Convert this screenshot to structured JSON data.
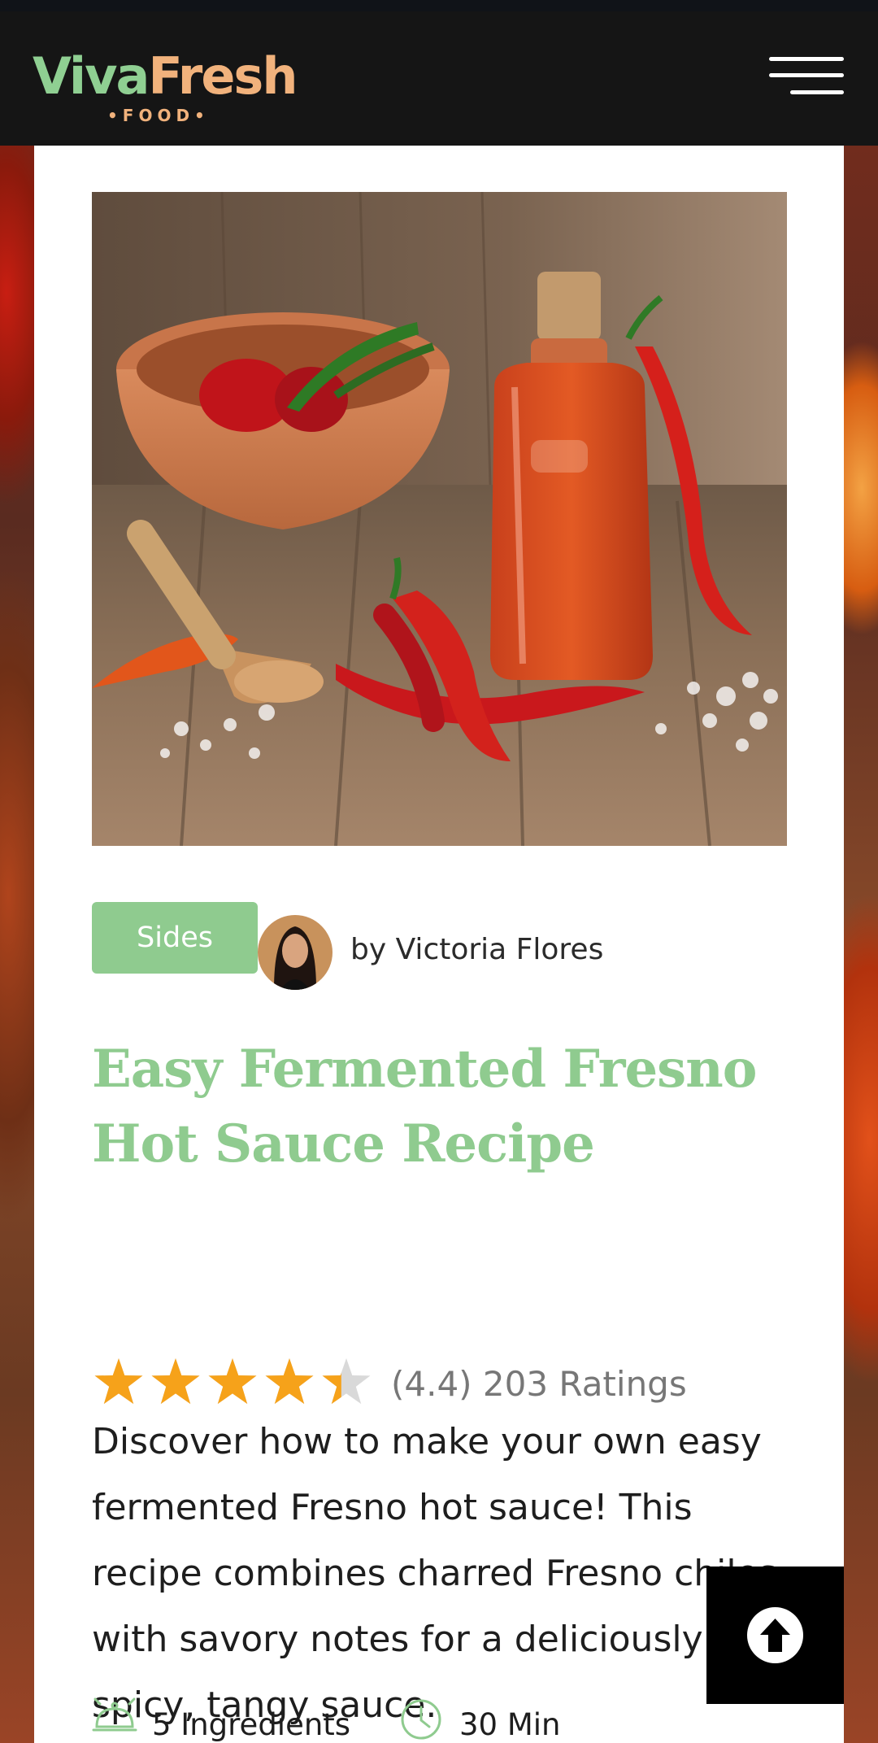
{
  "header": {
    "logo_viva": "Viva",
    "logo_fresh": "Fresh",
    "logo_sub": "•FOOD•",
    "menu_icon": "hamburger-menu-icon"
  },
  "recipe": {
    "hero_image": "hot-sauce-bottle-with-red-chiles",
    "category": "Sides",
    "author_prefix": "by",
    "author": "Victoria Flores",
    "author_line": "by Victoria Flores",
    "title": "Easy Fermented Fresno Hot Sauce Recipe",
    "rating": {
      "value": 4.4,
      "max": 5,
      "text": "(4.4) 203 Ratings",
      "star_color": "#f6a21a",
      "empty_star_color": "#d9d9d9"
    },
    "description": "Discover how to make your own easy fermented Fresno hot sauce! This recipe combines charred Fresno chiles with savory notes for a deliciously spicy, tangy sauce.",
    "ingredients_label": "5 Ingredients",
    "ingredients_icon": "cloche-icon",
    "time_label": "30 Min",
    "time_icon": "clock-icon"
  },
  "scroll_top": {
    "icon": "arrow-up-circle-icon"
  },
  "colors": {
    "brand_green": "#8fcb8f",
    "brand_orange": "#f1b27c",
    "header_bg": "#151515"
  }
}
